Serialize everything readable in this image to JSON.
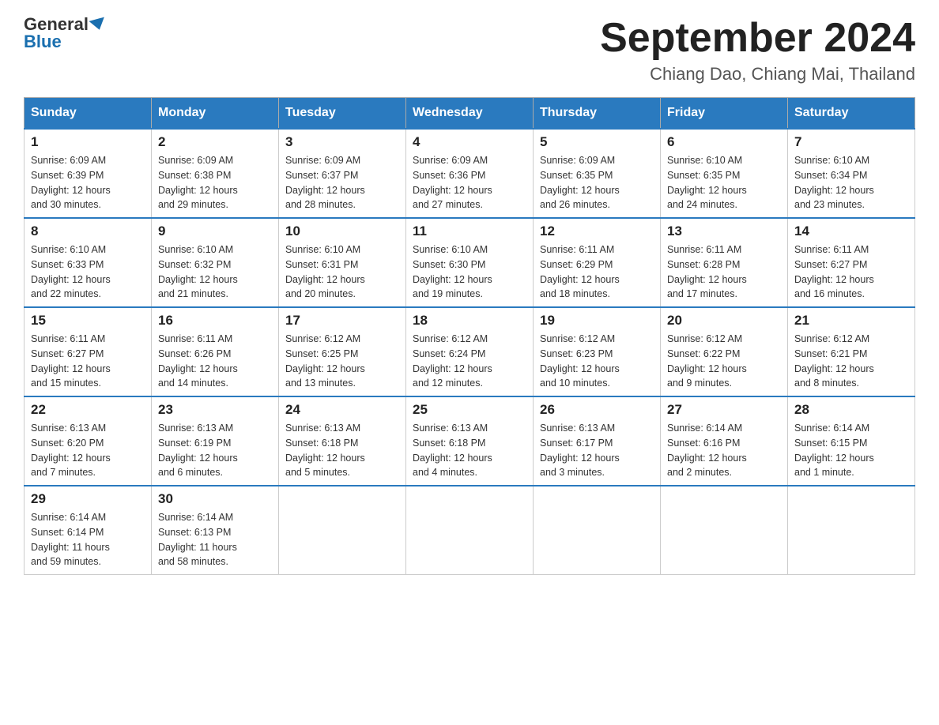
{
  "header": {
    "logo_general": "General",
    "logo_blue": "Blue",
    "month_title": "September 2024",
    "location": "Chiang Dao, Chiang Mai, Thailand"
  },
  "weekdays": [
    "Sunday",
    "Monday",
    "Tuesday",
    "Wednesday",
    "Thursday",
    "Friday",
    "Saturday"
  ],
  "weeks": [
    [
      {
        "day": "1",
        "sunrise": "6:09 AM",
        "sunset": "6:39 PM",
        "daylight": "12 hours and 30 minutes."
      },
      {
        "day": "2",
        "sunrise": "6:09 AM",
        "sunset": "6:38 PM",
        "daylight": "12 hours and 29 minutes."
      },
      {
        "day": "3",
        "sunrise": "6:09 AM",
        "sunset": "6:37 PM",
        "daylight": "12 hours and 28 minutes."
      },
      {
        "day": "4",
        "sunrise": "6:09 AM",
        "sunset": "6:36 PM",
        "daylight": "12 hours and 27 minutes."
      },
      {
        "day": "5",
        "sunrise": "6:09 AM",
        "sunset": "6:35 PM",
        "daylight": "12 hours and 26 minutes."
      },
      {
        "day": "6",
        "sunrise": "6:10 AM",
        "sunset": "6:35 PM",
        "daylight": "12 hours and 24 minutes."
      },
      {
        "day": "7",
        "sunrise": "6:10 AM",
        "sunset": "6:34 PM",
        "daylight": "12 hours and 23 minutes."
      }
    ],
    [
      {
        "day": "8",
        "sunrise": "6:10 AM",
        "sunset": "6:33 PM",
        "daylight": "12 hours and 22 minutes."
      },
      {
        "day": "9",
        "sunrise": "6:10 AM",
        "sunset": "6:32 PM",
        "daylight": "12 hours and 21 minutes."
      },
      {
        "day": "10",
        "sunrise": "6:10 AM",
        "sunset": "6:31 PM",
        "daylight": "12 hours and 20 minutes."
      },
      {
        "day": "11",
        "sunrise": "6:10 AM",
        "sunset": "6:30 PM",
        "daylight": "12 hours and 19 minutes."
      },
      {
        "day": "12",
        "sunrise": "6:11 AM",
        "sunset": "6:29 PM",
        "daylight": "12 hours and 18 minutes."
      },
      {
        "day": "13",
        "sunrise": "6:11 AM",
        "sunset": "6:28 PM",
        "daylight": "12 hours and 17 minutes."
      },
      {
        "day": "14",
        "sunrise": "6:11 AM",
        "sunset": "6:27 PM",
        "daylight": "12 hours and 16 minutes."
      }
    ],
    [
      {
        "day": "15",
        "sunrise": "6:11 AM",
        "sunset": "6:27 PM",
        "daylight": "12 hours and 15 minutes."
      },
      {
        "day": "16",
        "sunrise": "6:11 AM",
        "sunset": "6:26 PM",
        "daylight": "12 hours and 14 minutes."
      },
      {
        "day": "17",
        "sunrise": "6:12 AM",
        "sunset": "6:25 PM",
        "daylight": "12 hours and 13 minutes."
      },
      {
        "day": "18",
        "sunrise": "6:12 AM",
        "sunset": "6:24 PM",
        "daylight": "12 hours and 12 minutes."
      },
      {
        "day": "19",
        "sunrise": "6:12 AM",
        "sunset": "6:23 PM",
        "daylight": "12 hours and 10 minutes."
      },
      {
        "day": "20",
        "sunrise": "6:12 AM",
        "sunset": "6:22 PM",
        "daylight": "12 hours and 9 minutes."
      },
      {
        "day": "21",
        "sunrise": "6:12 AM",
        "sunset": "6:21 PM",
        "daylight": "12 hours and 8 minutes."
      }
    ],
    [
      {
        "day": "22",
        "sunrise": "6:13 AM",
        "sunset": "6:20 PM",
        "daylight": "12 hours and 7 minutes."
      },
      {
        "day": "23",
        "sunrise": "6:13 AM",
        "sunset": "6:19 PM",
        "daylight": "12 hours and 6 minutes."
      },
      {
        "day": "24",
        "sunrise": "6:13 AM",
        "sunset": "6:18 PM",
        "daylight": "12 hours and 5 minutes."
      },
      {
        "day": "25",
        "sunrise": "6:13 AM",
        "sunset": "6:18 PM",
        "daylight": "12 hours and 4 minutes."
      },
      {
        "day": "26",
        "sunrise": "6:13 AM",
        "sunset": "6:17 PM",
        "daylight": "12 hours and 3 minutes."
      },
      {
        "day": "27",
        "sunrise": "6:14 AM",
        "sunset": "6:16 PM",
        "daylight": "12 hours and 2 minutes."
      },
      {
        "day": "28",
        "sunrise": "6:14 AM",
        "sunset": "6:15 PM",
        "daylight": "12 hours and 1 minute."
      }
    ],
    [
      {
        "day": "29",
        "sunrise": "6:14 AM",
        "sunset": "6:14 PM",
        "daylight": "11 hours and 59 minutes."
      },
      {
        "day": "30",
        "sunrise": "6:14 AM",
        "sunset": "6:13 PM",
        "daylight": "11 hours and 58 minutes."
      },
      null,
      null,
      null,
      null,
      null
    ]
  ],
  "labels": {
    "sunrise": "Sunrise:",
    "sunset": "Sunset:",
    "daylight": "Daylight:"
  }
}
